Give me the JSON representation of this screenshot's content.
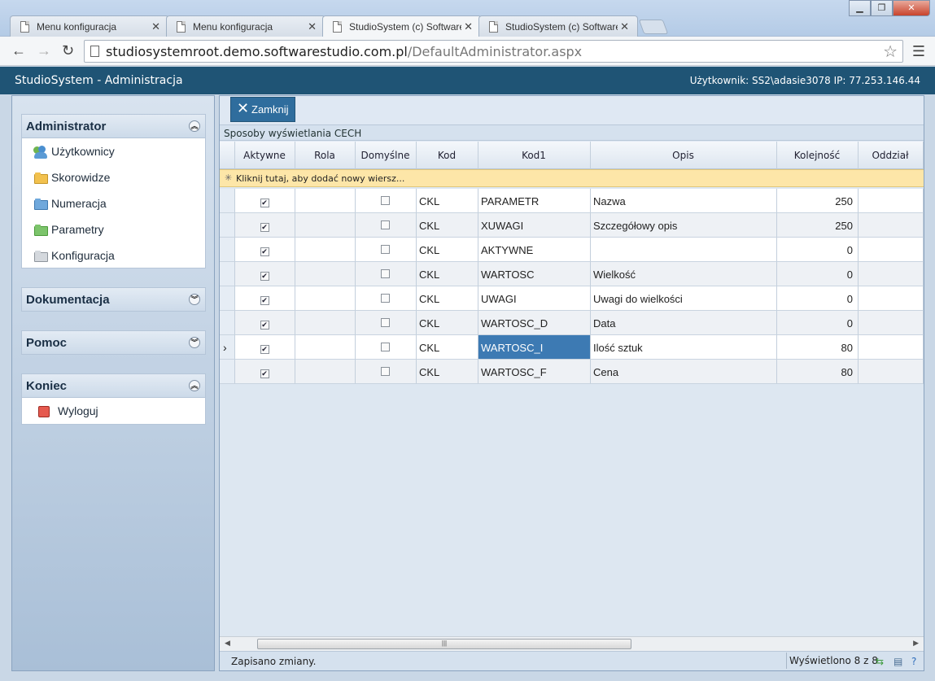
{
  "browser": {
    "tabs": [
      {
        "label": "Menu konfiguracja"
      },
      {
        "label": "Menu konfiguracja"
      },
      {
        "label": "StudioSystem (c) Software"
      },
      {
        "label": "StudioSystem (c) Software"
      }
    ],
    "url_host": "studiosystemroot.demo.softwarestudio.com.pl",
    "url_path": "/DefaultAdministrator.aspx"
  },
  "app": {
    "title": "StudioSystem - Administracja",
    "user_info": "Użytkownik: SS2\\adasie3078 IP: 77.253.146.44"
  },
  "sidebar": {
    "panels": [
      {
        "title": "Administrator",
        "items": [
          {
            "label": "Użytkownicy",
            "icon": "users-icon"
          },
          {
            "label": "Skorowidze",
            "icon": "folder-yellow-icon"
          },
          {
            "label": "Numeracja",
            "icon": "folder-blue-icon"
          },
          {
            "label": "Parametry",
            "icon": "folder-green-icon"
          },
          {
            "label": "Konfiguracja",
            "icon": "folder-gray-icon"
          }
        ]
      },
      {
        "title": "Dokumentacja"
      },
      {
        "title": "Pomoc"
      },
      {
        "title": "Koniec",
        "items": [
          {
            "label": "Wyloguj",
            "icon": "logout-icon"
          }
        ]
      }
    ]
  },
  "main": {
    "close_label": "Zamknij",
    "grid_caption": "Sposoby wyświetlania CECH",
    "new_row_text": "Kliknij tutaj, aby dodać nowy wiersz...",
    "columns": [
      "Aktywne",
      "Rola",
      "Domyślne",
      "Kod",
      "Kod1",
      "Opis",
      "Kolejność",
      "Oddział"
    ],
    "rows": [
      {
        "aktywne": true,
        "rola": "",
        "domyslne": false,
        "kod": "CKL",
        "kod1": "PARAMETR",
        "opis": "Nazwa",
        "kolejnosc": "250",
        "oddzial": ""
      },
      {
        "aktywne": true,
        "rola": "",
        "domyslne": false,
        "kod": "CKL",
        "kod1": "XUWAGI",
        "opis": "Szczegółowy opis",
        "kolejnosc": "250",
        "oddzial": ""
      },
      {
        "aktywne": true,
        "rola": "",
        "domyslne": false,
        "kod": "CKL",
        "kod1": "AKTYWNE",
        "opis": "",
        "kolejnosc": "0",
        "oddzial": ""
      },
      {
        "aktywne": true,
        "rola": "",
        "domyslne": false,
        "kod": "CKL",
        "kod1": "WARTOSC",
        "opis": "Wielkość",
        "kolejnosc": "0",
        "oddzial": ""
      },
      {
        "aktywne": true,
        "rola": "",
        "domyslne": false,
        "kod": "CKL",
        "kod1": "UWAGI",
        "opis": "Uwagi do wielkości",
        "kolejnosc": "0",
        "oddzial": ""
      },
      {
        "aktywne": true,
        "rola": "",
        "domyslne": false,
        "kod": "CKL",
        "kod1": "WARTOSC_D",
        "opis": "Data",
        "kolejnosc": "0",
        "oddzial": ""
      },
      {
        "aktywne": true,
        "rola": "",
        "domyslne": false,
        "kod": "CKL",
        "kod1": "WARTOSC_I",
        "opis": "Ilość sztuk",
        "kolejnosc": "80",
        "oddzial": "",
        "current": true
      },
      {
        "aktywne": true,
        "rola": "",
        "domyslne": false,
        "kod": "CKL",
        "kod1": "WARTOSC_F",
        "opis": "Cena",
        "kolejnosc": "80",
        "oddzial": ""
      }
    ],
    "status_message": "Zapisano zmiany.",
    "status_count": "Wyświetlono 8 z 8"
  },
  "colors": {
    "header_bg": "#1f5475",
    "button_bg": "#2f6d9d",
    "selected_cell": "#3d7ab3",
    "new_row_bg": "#fde6a8"
  }
}
